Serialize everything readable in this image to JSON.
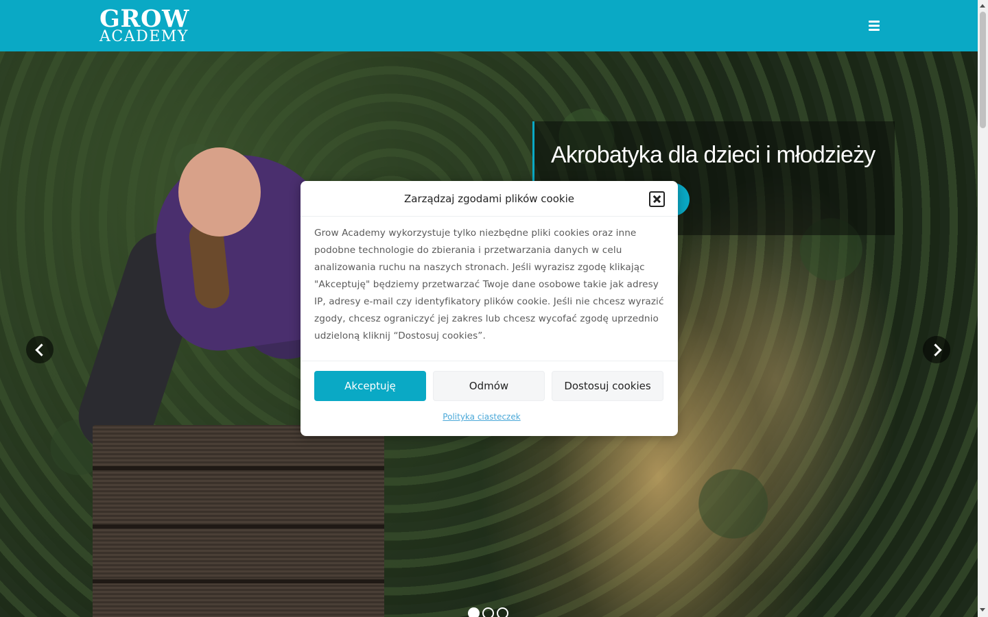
{
  "header": {
    "logo_line1": "GROW",
    "logo_line2": "ACADEMY",
    "menu_icon": "hamburger-menu-icon",
    "background_color": "#0aa9c5"
  },
  "hero": {
    "slide_title": "Akrobatyka dla dzieci i młodzieży",
    "prev_icon": "chevron-left-icon",
    "next_icon": "chevron-right-icon",
    "slides_count": 3,
    "active_slide": 1
  },
  "cookie_modal": {
    "title": "Zarządzaj zgodami plików cookie",
    "body": "Grow Academy wykorzystuje tylko niezbędne pliki cookies oraz inne podobne technologie do zbierania i przetwarzania danych w celu analizowania ruchu na naszych stronach. Jeśli wyrazisz zgodę klikając \"Akceptuję\" będziemy przetwarzać Twoje dane osobowe takie jak adresy IP, adresy e-mail czy identyfikatory plików cookie. Jeśli nie chcesz wyrazić zgody, chcesz ograniczyć jej zakres lub chcesz wycofać zgodę uprzednio udzieloną kliknij “Dostosuj cookies”.",
    "accept_label": "Akceptuję",
    "deny_label": "Odmów",
    "customize_label": "Dostosuj cookies",
    "policy_link": "Polityka ciasteczek",
    "close_icon": "close-icon",
    "accent_color": "#0aa9c5"
  }
}
